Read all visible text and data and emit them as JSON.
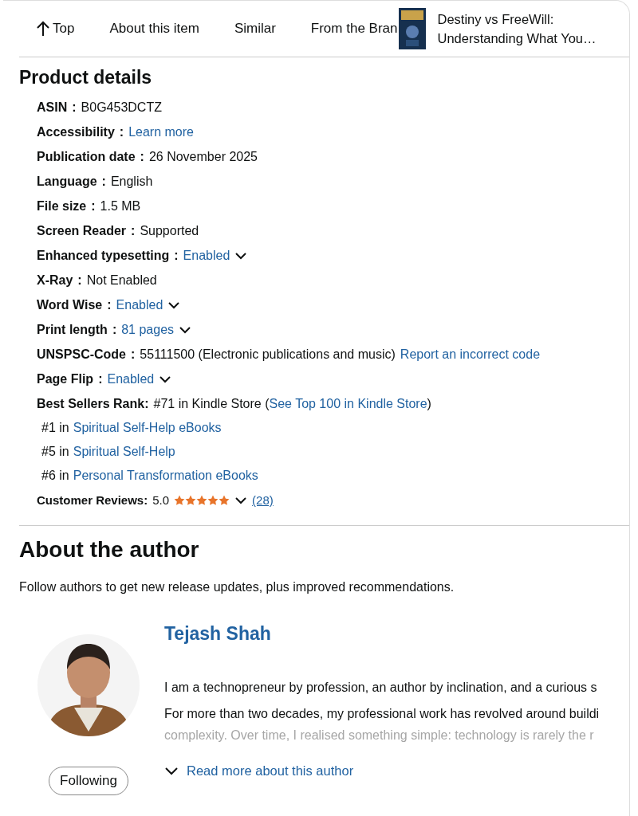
{
  "nav": {
    "items": [
      {
        "label": "Top",
        "kind": "top"
      },
      {
        "label": "About this item",
        "kind": "link"
      },
      {
        "label": "Similar",
        "kind": "link"
      },
      {
        "label": "From the Bran",
        "kind": "link"
      }
    ],
    "book": {
      "title_lines": [
        "Destiny vs FreeWill:",
        "Understanding What You…"
      ]
    }
  },
  "product_details": {
    "heading": "Product details",
    "rows": [
      {
        "label": "ASIN",
        "separator": ":",
        "parts": [
          {
            "text": "B0G453DCTZ",
            "kind": "text"
          }
        ],
        "dropdown": false
      },
      {
        "label": "Accessibility",
        "separator": ":",
        "parts": [
          {
            "text": "Learn more",
            "kind": "link"
          }
        ],
        "dropdown": false
      },
      {
        "label": "Publication date",
        "separator": ":",
        "parts": [
          {
            "text": "26 November 2025",
            "kind": "text"
          }
        ],
        "dropdown": false
      },
      {
        "label": "Language",
        "separator": ":",
        "parts": [
          {
            "text": "English",
            "kind": "text"
          }
        ],
        "dropdown": false
      },
      {
        "label": "File size",
        "separator": ":",
        "parts": [
          {
            "text": "1.5 MB",
            "kind": "text"
          }
        ],
        "dropdown": false
      },
      {
        "label": "Screen Reader",
        "separator": ":",
        "parts": [
          {
            "text": "Supported",
            "kind": "text"
          }
        ],
        "dropdown": false
      },
      {
        "label": "Enhanced typesetting",
        "separator": ":",
        "parts": [
          {
            "text": "Enabled",
            "kind": "link"
          }
        ],
        "dropdown": true
      },
      {
        "label": "X-Ray",
        "separator": ":",
        "parts": [
          {
            "text": "Not Enabled",
            "kind": "text"
          }
        ],
        "dropdown": false
      },
      {
        "label": "Word Wise",
        "separator": ":",
        "parts": [
          {
            "text": "Enabled",
            "kind": "link"
          }
        ],
        "dropdown": true
      },
      {
        "label": "Print length",
        "separator": ":",
        "parts": [
          {
            "text": "81 pages",
            "kind": "link"
          }
        ],
        "dropdown": true
      },
      {
        "label": "UNSPSC-Code",
        "separator": ":",
        "parts": [
          {
            "text": "55111500 (Electronic publications and music)",
            "kind": "text"
          },
          {
            "text": "Report an incorrect code",
            "kind": "link"
          }
        ],
        "dropdown": false
      },
      {
        "label": "Page Flip",
        "separator": ":",
        "parts": [
          {
            "text": "Enabled",
            "kind": "link"
          }
        ],
        "dropdown": true
      }
    ],
    "best_sellers": {
      "label": "Best Sellers Rank:",
      "main": "#71 in Kindle Store (",
      "main_link": "See Top 100 in Kindle Store",
      "main_end": ")",
      "ranks": [
        {
          "rank": "#1 in",
          "category": "Spiritual Self-Help eBooks"
        },
        {
          "rank": "#5 in",
          "category": "Spiritual Self-Help"
        },
        {
          "rank": "#6 in",
          "category": "Personal Transformation eBooks"
        }
      ]
    },
    "reviews": {
      "label": "Customer Reviews:",
      "rating": "5.0",
      "stars": 5,
      "count": "(28)"
    }
  },
  "about_author": {
    "heading": "About the author",
    "follow_text": "Follow authors to get new release updates, plus improved recommendations.",
    "name": "Tejash Shah",
    "follow_button": "Following",
    "bio": [
      {
        "text": "I am a technopreneur by profession, an author by inclination, and a curious s",
        "faded": false
      },
      {
        "text": "For more than two decades, my professional work has revolved around buildi",
        "faded": false
      },
      {
        "text": "complexity. Over time, I realised something simple: technology is rarely the r",
        "faded": true
      }
    ],
    "read_more": "Read more about this author"
  }
}
